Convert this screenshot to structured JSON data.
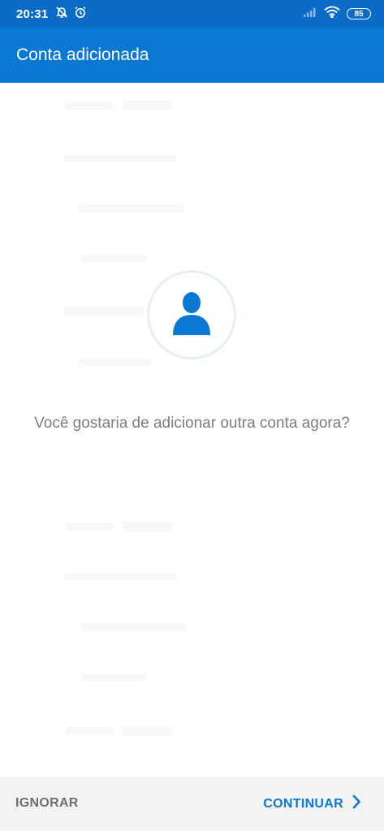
{
  "status_bar": {
    "time": "20:31",
    "icons_left": [
      "notifications-muted-icon",
      "alarm-icon"
    ],
    "icons_right": [
      "signal-icon",
      "wifi-icon",
      "battery-icon"
    ],
    "battery_level": "85"
  },
  "app_bar": {
    "title": "Conta adicionada"
  },
  "main": {
    "icon": "person-icon",
    "prompt": "Você gostaria de adicionar outra conta agora?"
  },
  "actions": {
    "ignore_label": "IGNORAR",
    "continue_label": "CONTINUAR",
    "continue_icon": "chevron-right-icon"
  },
  "colors": {
    "status_bar": "#0a6cc6",
    "app_bar": "#0b78d4",
    "accent": "#0b78d4",
    "prompt_text": "#7d7d7d",
    "bottom_bar": "#f3f3f3"
  }
}
